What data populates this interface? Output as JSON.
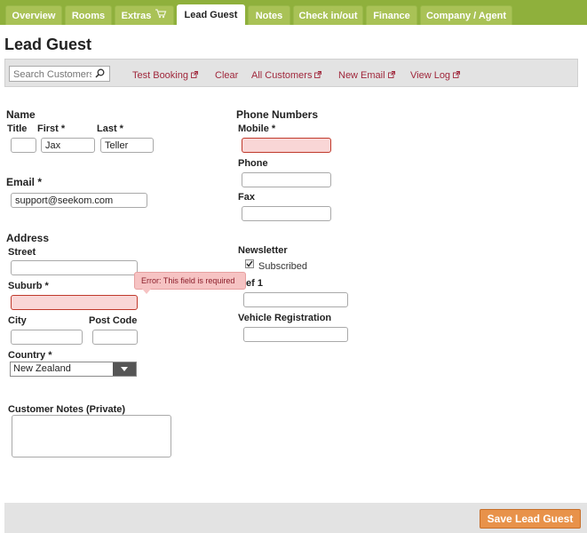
{
  "tabs": [
    {
      "label": "Overview"
    },
    {
      "label": "Rooms"
    },
    {
      "label": "Extras"
    },
    {
      "label": "Lead Guest"
    },
    {
      "label": "Notes"
    },
    {
      "label": "Check in/out"
    },
    {
      "label": "Finance"
    },
    {
      "label": "Company / Agent"
    }
  ],
  "page_title": "Lead Guest",
  "toolbar": {
    "search_placeholder": "Search Customers",
    "links": {
      "test_booking": "Test Booking",
      "clear": "Clear",
      "all_customers": "All Customers",
      "new_email": "New Email",
      "view_log": "View Log"
    }
  },
  "name": {
    "section": "Name",
    "title_label": "Title",
    "first_label": "First *",
    "last_label": "Last *",
    "title_value": "",
    "first_value": "Jax",
    "last_value": "Teller"
  },
  "email": {
    "label": "Email *",
    "value": "support@seekom.com"
  },
  "address": {
    "section": "Address",
    "street_label": "Street",
    "suburb_label": "Suburb *",
    "city_label": "City",
    "postcode_label": "Post Code",
    "country_label": "Country *",
    "country_value": "New Zealand"
  },
  "error_tooltip": "Error: This field is required",
  "notes_label": "Customer Notes (Private)",
  "phone": {
    "section": "Phone Numbers",
    "mobile_label": "Mobile *",
    "phone_label": "Phone",
    "fax_label": "Fax"
  },
  "newsletter": {
    "label": "Newsletter",
    "checkbox_label": "Subscribed",
    "checked": true
  },
  "ref1_label": "ef 1",
  "vehicle_label": "Vehicle Registration",
  "save_button": "Save Lead Guest",
  "colors": {
    "tabbar": "#8fb03c",
    "error": "#f9d6d6",
    "link": "#a0283c",
    "save": "#e8924a"
  }
}
